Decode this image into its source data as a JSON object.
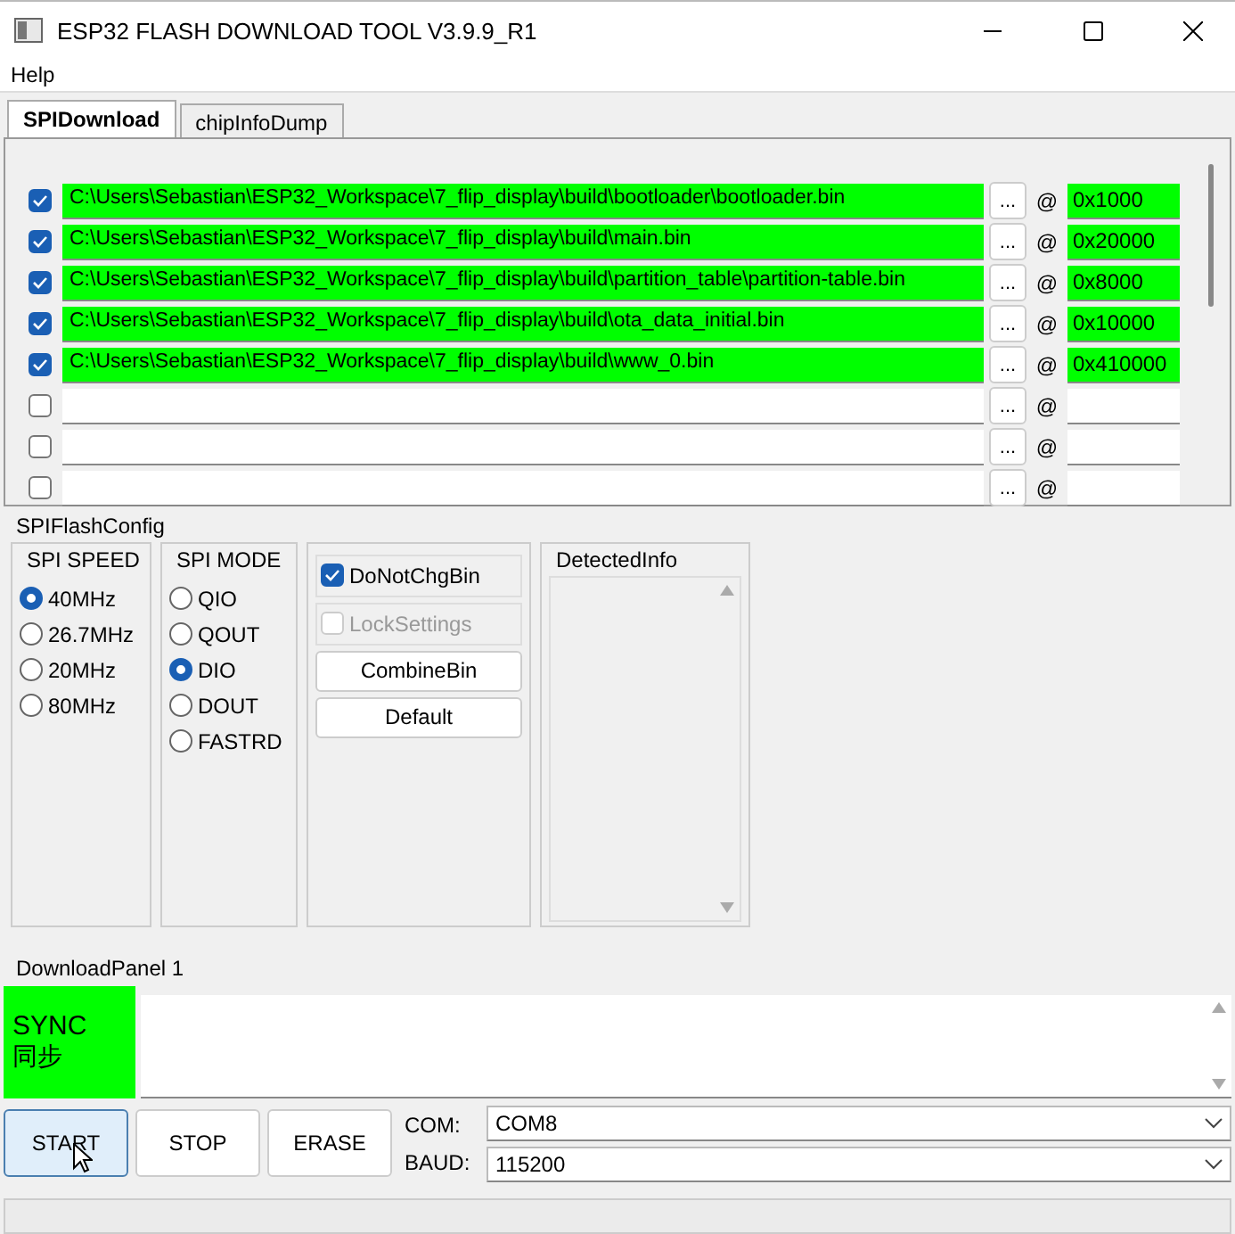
{
  "window": {
    "title": "ESP32 FLASH DOWNLOAD TOOL V3.9.9_R1"
  },
  "menu": [
    "Help"
  ],
  "tabs": [
    {
      "label": "SPIDownload",
      "selected": true
    },
    {
      "label": "chipInfoDump",
      "selected": false
    }
  ],
  "files": [
    {
      "checked": true,
      "path": "C:\\Users\\Sebastian\\ESP32_Workspace\\7_flip_display\\build\\bootloader\\bootloader.bin",
      "browse": "...",
      "at": "@",
      "address": "0x1000"
    },
    {
      "checked": true,
      "path": "C:\\Users\\Sebastian\\ESP32_Workspace\\7_flip_display\\build\\main.bin",
      "browse": "...",
      "at": "@",
      "address": "0x20000"
    },
    {
      "checked": true,
      "path": "C:\\Users\\Sebastian\\ESP32_Workspace\\7_flip_display\\build\\partition_table\\partition-table.bin",
      "browse": "...",
      "at": "@",
      "address": "0x8000"
    },
    {
      "checked": true,
      "path": "C:\\Users\\Sebastian\\ESP32_Workspace\\7_flip_display\\build\\ota_data_initial.bin",
      "browse": "...",
      "at": "@",
      "address": "0x10000"
    },
    {
      "checked": true,
      "path": "C:\\Users\\Sebastian\\ESP32_Workspace\\7_flip_display\\build\\www_0.bin",
      "browse": "...",
      "at": "@",
      "address": "0x410000"
    },
    {
      "checked": false,
      "browse": "...",
      "at": "@"
    },
    {
      "checked": false,
      "browse": "...",
      "at": "@"
    },
    {
      "checked": false,
      "browse": "...",
      "at": "@"
    }
  ],
  "spi_flash_config": {
    "title": "SPIFlashConfig",
    "spi_speed": {
      "title": "SPI SPEED",
      "options": [
        {
          "label": "40MHz",
          "selected": true
        },
        {
          "label": "26.7MHz",
          "selected": false
        },
        {
          "label": "20MHz",
          "selected": false
        },
        {
          "label": "80MHz",
          "selected": false
        }
      ]
    },
    "spi_mode": {
      "title": "SPI MODE",
      "options": [
        {
          "label": "QIO",
          "selected": false
        },
        {
          "label": "QOUT",
          "selected": false
        },
        {
          "label": "DIO",
          "selected": true
        },
        {
          "label": "DOUT",
          "selected": false
        },
        {
          "label": "FASTRD",
          "selected": false
        }
      ]
    },
    "do_not_chg_bin": {
      "label": "DoNotChgBin",
      "checked": true,
      "disabled": false
    },
    "lock_settings": {
      "label": "LockSettings",
      "checked": false,
      "disabled": true
    },
    "buttons": [
      "CombineBin",
      "Default"
    ],
    "detected_info": {
      "title": "DetectedInfo"
    }
  },
  "download_panel": {
    "title": "DownloadPanel 1",
    "status": "SYNC",
    "status_cn": "同步",
    "buttons": [
      {
        "label": "START",
        "selected": true
      },
      {
        "label": "STOP",
        "selected": false
      },
      {
        "label": "ERASE",
        "selected": false
      }
    ],
    "com": {
      "label": "COM:",
      "value": "COM8"
    },
    "baud": {
      "label": "BAUD:",
      "value": "115200"
    }
  }
}
